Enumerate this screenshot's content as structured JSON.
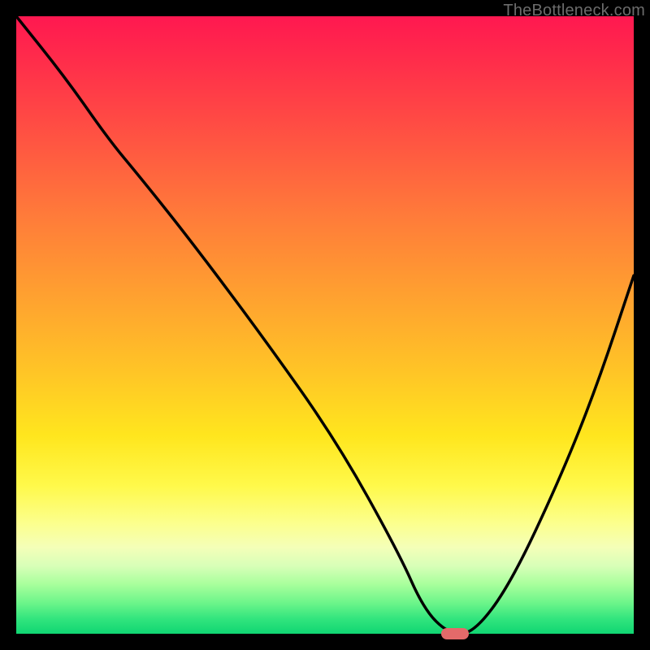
{
  "watermark": "TheBottleneck.com",
  "colors": {
    "frame": "#000000",
    "curve": "#000000",
    "marker": "#e46a6a",
    "gradient_top": "#ff1850",
    "gradient_bottom": "#10d672"
  },
  "chart_data": {
    "type": "line",
    "title": "",
    "xlabel": "",
    "ylabel": "",
    "xlim": [
      0,
      100
    ],
    "ylim": [
      0,
      100
    ],
    "grid": false,
    "series": [
      {
        "name": "bottleneck-curve",
        "x": [
          0,
          8,
          15,
          20,
          28,
          40,
          52,
          62,
          66,
          70,
          74,
          80,
          88,
          94,
          100
        ],
        "values": [
          100,
          90,
          80,
          74,
          64,
          48,
          31,
          13,
          4,
          0,
          0,
          8,
          25,
          40,
          58
        ]
      }
    ],
    "marker": {
      "x": 71,
      "y": 0
    },
    "annotations": []
  }
}
